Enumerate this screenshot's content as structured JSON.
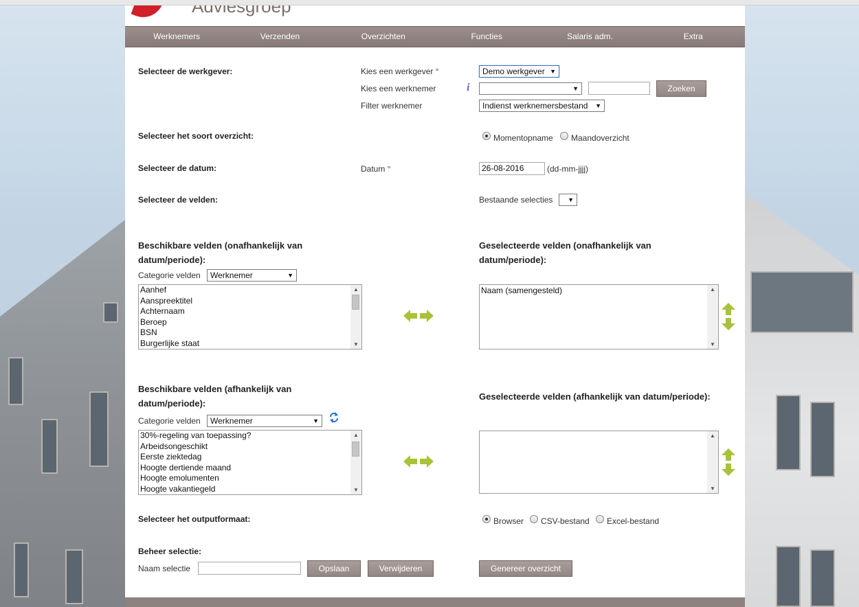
{
  "header": {
    "logo_text": "Adviesgroep"
  },
  "nav": [
    "Werknemers",
    "Verzenden",
    "Overzichten",
    "Functies",
    "Salaris adm.",
    "Extra"
  ],
  "werkgever": {
    "section_label": "Selecteer de werkgever:",
    "kies_werkgever_label": "Kies een werkgever °",
    "kies_werkgever_value": "Demo werkgever",
    "kies_werknemer_label": "Kies een werknemer",
    "kies_werknemer_value": "",
    "search_value": "",
    "zoeken_label": "Zoeken",
    "filter_label": "Filter werknemer",
    "filter_value": "Indienst werknemersbestand"
  },
  "soort": {
    "section_label": "Selecteer het soort overzicht:",
    "options": [
      "Momentopname",
      "Maandoverzicht"
    ],
    "selected": "Momentopname"
  },
  "datum": {
    "section_label": "Selecteer de datum:",
    "label": "Datum °",
    "value": "26-08-2016",
    "hint": "(dd-mm-jjjj)"
  },
  "velden": {
    "section_label": "Selecteer de velden:",
    "bestaande_label": "Bestaande selecties",
    "bestaande_value": ""
  },
  "onafhankelijk": {
    "available_heading_1": "Beschikbare velden (onafhankelijk van",
    "available_heading_2": "datum/periode):",
    "categorie_label": "Categorie velden",
    "categorie_value": "Werknemer",
    "available_items": [
      "Aanhef",
      "Aanspreektitel",
      "Achternaam",
      "Beroep",
      "BSN",
      "Burgerlijke staat"
    ],
    "selected_heading_1": "Geselecteerde velden (onafhankelijk van",
    "selected_heading_2": "datum/periode):",
    "selected_items": [
      "Naam (samengesteld)"
    ]
  },
  "afhankelijk": {
    "available_heading_1": "Beschikbare velden (afhankelijk van",
    "available_heading_2": "datum/periode):",
    "categorie_label": "Categorie velden",
    "categorie_value": "Werknemer",
    "available_items": [
      "30%-regeling van toepassing?",
      "Arbeidsongeschikt",
      "Eerste ziektedag",
      "Hoogte dertiende maand",
      "Hoogte emolumenten",
      "Hoogte vakantiegeld"
    ],
    "selected_heading": "Geselecteerde velden (afhankelijk van datum/periode):",
    "selected_items": []
  },
  "output": {
    "section_label": "Selecteer het outputformaat:",
    "options": [
      "Browser",
      "CSV-bestand",
      "Excel-bestand"
    ],
    "selected": "Browser"
  },
  "beheer": {
    "section_label": "Beheer selectie:",
    "naam_label": "Naam selectie",
    "naam_value": "",
    "opslaan_label": "Opslaan",
    "verwijderen_label": "Verwijderen",
    "genereer_label": "Genereer overzicht"
  },
  "colors": {
    "nav": "#8f8280",
    "arrow_green": "#a8c23a",
    "refresh_blue": "#2a6fd0"
  }
}
